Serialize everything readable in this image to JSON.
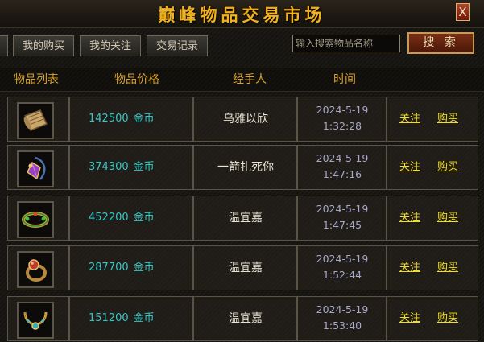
{
  "window": {
    "title": "巅峰物品交易市场",
    "close_label": "X"
  },
  "tabs": [
    {
      "label": "我的购买"
    },
    {
      "label": "我的关注"
    },
    {
      "label": "交易记录"
    }
  ],
  "search": {
    "placeholder": "输入搜索物品名称",
    "button_label": "搜 索"
  },
  "columns": {
    "item": "物品列表",
    "price": "物品价格",
    "handler": "经手人",
    "time": "时间"
  },
  "rows": [
    {
      "icon": "scroll-icon",
      "price": "142500",
      "currency": "金币",
      "handler": "乌雅以欣",
      "date": "2024-5-19",
      "clock": "1:32:28",
      "follow": "关注",
      "buy": "购买"
    },
    {
      "icon": "gem-amulet-icon",
      "price": "374300",
      "currency": "金币",
      "handler": "一箭扎死你",
      "date": "2024-5-19",
      "clock": "1:47:16",
      "follow": "关注",
      "buy": "购买"
    },
    {
      "icon": "bracelet-icon",
      "price": "452200",
      "currency": "金币",
      "handler": "温宜嘉",
      "date": "2024-5-19",
      "clock": "1:47:45",
      "follow": "关注",
      "buy": "购买"
    },
    {
      "icon": "ring-icon",
      "price": "287700",
      "currency": "金币",
      "handler": "温宜嘉",
      "date": "2024-5-19",
      "clock": "1:52:44",
      "follow": "关注",
      "buy": "购买"
    },
    {
      "icon": "necklace-icon",
      "price": "151200",
      "currency": "金币",
      "handler": "温宜嘉",
      "date": "2024-5-19",
      "clock": "1:53:40",
      "follow": "关注",
      "buy": "购买"
    }
  ],
  "colors": {
    "title": "#f2b21e",
    "header": "#d9a22a",
    "price": "#33c8c8",
    "link": "#f0de28",
    "time": "#a8a8c8"
  }
}
